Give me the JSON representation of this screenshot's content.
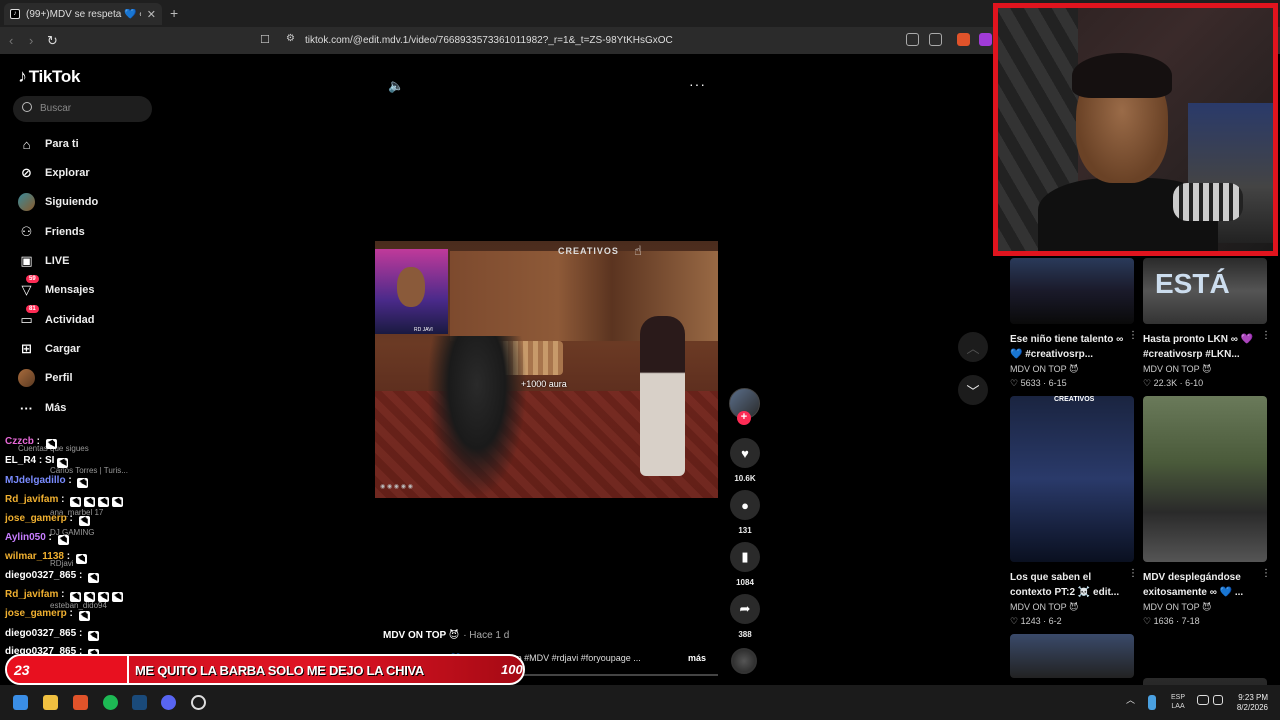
{
  "browser": {
    "tab_title": "(99+)MDV se respeta 💙 ∞ #",
    "tab_close": "✕",
    "new_tab": "+",
    "url": "tiktok.com/@edit.mdv.1/video/7668933573361011982?_r=1&_t=ZS-98YtKHsGxOC"
  },
  "sidebar": {
    "logo": "TikTok",
    "search_placeholder": "Buscar",
    "items": [
      {
        "label": "Para ti",
        "icon": "home-icon"
      },
      {
        "label": "Explorar",
        "icon": "compass-icon"
      },
      {
        "label": "Siguiendo",
        "icon": "avatar"
      },
      {
        "label": "Friends",
        "icon": "friends-icon"
      },
      {
        "label": "LIVE",
        "icon": "live-icon"
      },
      {
        "label": "Mensajes",
        "icon": "send-icon",
        "badge": "59"
      },
      {
        "label": "Actividad",
        "icon": "activity-icon",
        "badge": "81"
      },
      {
        "label": "Cargar",
        "icon": "upload-icon"
      },
      {
        "label": "Perfil",
        "icon": "avatar"
      },
      {
        "label": "Más",
        "icon": "more-icon"
      }
    ],
    "following_header": "Cuentas que sigues",
    "following_ghosts": [
      "Carlos Torres | Turis...",
      "ana_marbel 17",
      "DJ GAMING",
      "RDjavi",
      "esteban_dido94"
    ]
  },
  "video": {
    "brand": "CREATIVOS",
    "aura_text": "+1000 aura",
    "cam_name": "RD JAVI",
    "author": "MDV ON TOP 😈",
    "time_ago": "· Hace 1 d",
    "caption": "MDV se respeta 💙 ∞ #creativosrp #MDV #rdjavi #foryoupage ...",
    "more_label": "más",
    "likes": "10.6K",
    "comments": "131",
    "saves": "1084",
    "shares": "388"
  },
  "chat": [
    {
      "user": "Czzcb",
      "color": "#e86ad8",
      "text": ""
    },
    {
      "user": "EL_R4",
      "color": "#ffffff",
      "text": "SI"
    },
    {
      "user": "MJdelgadillo",
      "color": "#7a8cff",
      "text": ""
    },
    {
      "user": "Rd_javifam",
      "color": "#f0b030",
      "text": ""
    },
    {
      "user": "jose_gamerp",
      "color": "#f0b030",
      "text": ""
    },
    {
      "user": "Aylin050",
      "color": "#c77dff",
      "text": ""
    },
    {
      "user": "wilmar_1138",
      "color": "#f0b030",
      "text": ""
    },
    {
      "user": "diego0327_865",
      "color": "#ffffff",
      "text": ""
    },
    {
      "user": "Rd_javifam",
      "color": "#f0b030",
      "text": ""
    },
    {
      "user": "jose_gamerp",
      "color": "#f0b030",
      "text": ""
    },
    {
      "user": "diego0327_865",
      "color": "#ffffff",
      "text": ""
    },
    {
      "user": "diego0327_865",
      "color": "#ffffff",
      "text": ""
    },
    {
      "user": "Aylin050",
      "color": "#c77dff",
      "text": ""
    }
  ],
  "recommended": [
    {
      "title": "Ese niño tiene talento ∞ 💙 #creativosrp...",
      "author": "MDV ON TOP 😈",
      "likes": "5633",
      "date": "6-15",
      "overlay": ""
    },
    {
      "title": "Hasta pronto LKN ∞ 💜 #creativosrp #LKN...",
      "author": "MDV ON TOP 😈",
      "likes": "22.3K",
      "date": "6-10",
      "overlay": "ESTÁ"
    },
    {
      "title": "Los que saben el contexto PT:2 ☠️ edit...",
      "author": "MDV ON TOP 😈",
      "likes": "1243",
      "date": "6-2",
      "overlay": "CREATIVOS"
    },
    {
      "title": "MDV desplegándose exitosamente ∞ 💙 ...",
      "author": "MDV ON TOP 😈",
      "likes": "1636",
      "date": "7-18",
      "overlay": ""
    }
  ],
  "banner": {
    "level": "23",
    "text": "ME QUITO LA BARBA SOLO ME DEJO LA CHIVA",
    "target": "100"
  },
  "taskbar": {
    "lang_line1": "ESP",
    "lang_line2": "LAA",
    "time": "9:23 PM",
    "date": "8/2/2026"
  }
}
